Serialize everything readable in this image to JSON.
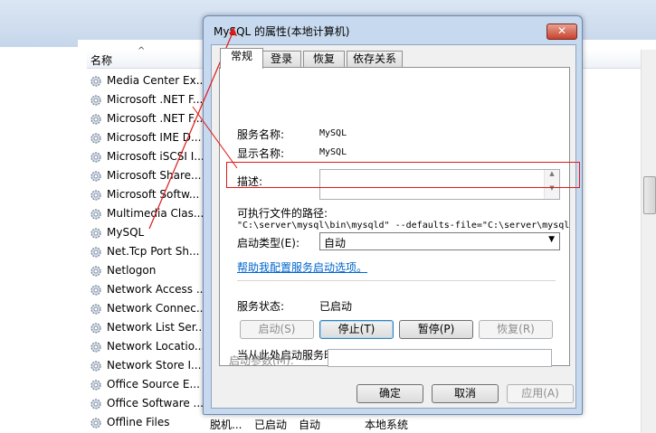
{
  "services_list": {
    "column_header": "名称",
    "rows": [
      {
        "name": "Media Center Ex..."
      },
      {
        "name": "Microsoft .NET F..."
      },
      {
        "name": "Microsoft .NET F..."
      },
      {
        "name": "Microsoft IME D..."
      },
      {
        "name": "Microsoft iSCSI I..."
      },
      {
        "name": "Microsoft Share..."
      },
      {
        "name": "Microsoft Softw..."
      },
      {
        "name": "Multimedia Clas..."
      },
      {
        "name": "MySQL"
      },
      {
        "name": "Net.Tcp Port Sh..."
      },
      {
        "name": "Netlogon"
      },
      {
        "name": "Network Access ..."
      },
      {
        "name": "Network Connec..."
      },
      {
        "name": "Network List Ser..."
      },
      {
        "name": "Network Locatio..."
      },
      {
        "name": "Network Store I..."
      },
      {
        "name": "Office  Source E..."
      },
      {
        "name": "Office Software ..."
      },
      {
        "name": "Offline Files",
        "description": "脱机...",
        "status": "已启动",
        "startup": "自动",
        "logon": "本地系统"
      }
    ]
  },
  "dialog": {
    "title": "MySQL 的属性(本地计算机)",
    "close_label": "✕",
    "tabs": [
      "常规",
      "登录",
      "恢复",
      "依存关系"
    ],
    "service_name_label": "服务名称:",
    "service_name_value": "MySQL",
    "display_name_label": "显示名称:",
    "display_name_value": "MySQL",
    "description_label": "描述:",
    "description_value": "",
    "exe_path_label": "可执行文件的路径:",
    "exe_path_value": "\"C:\\server\\mysql\\bin\\mysqld\" --defaults-file=\"C:\\server\\mysql",
    "startup_type_label": "启动类型(E):",
    "startup_type_value": "自动",
    "help_link": "帮助我配置服务启动选项。",
    "status_label": "服务状态:",
    "status_value": "已启动",
    "buttons": {
      "start": "启动(S)",
      "stop": "停止(T)",
      "pause": "暂停(P)",
      "resume": "恢复(R)"
    },
    "hint": "当从此处启动服务时，您可指定所适用的启动参数。",
    "params_label": "启动参数(M):",
    "params_value": "",
    "footer": {
      "ok": "确定",
      "cancel": "取消",
      "apply": "应用(A)"
    }
  },
  "colors": {
    "annotation_red": "#e01818",
    "link_blue": "#0066cc"
  },
  "icons": {
    "service": "gear-icon",
    "dropdown": "chevron-down-icon",
    "close": "close-icon"
  }
}
